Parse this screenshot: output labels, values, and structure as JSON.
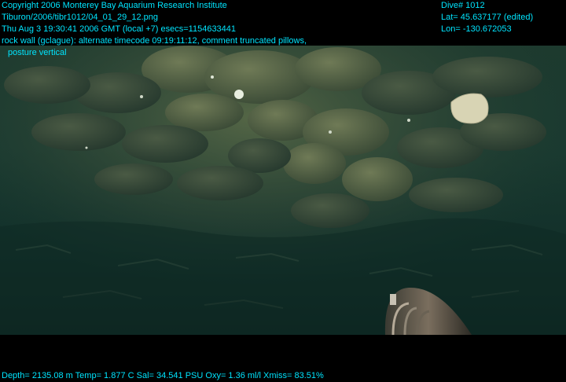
{
  "header_left": {
    "line1": "Copyright 2006 Monterey Bay Aquarium Research Institute",
    "line2": "Tiburon/2006/tibr1012/04_01_29_12.png",
    "line3": "Thu Aug  3 19:30:41 2006 GMT (local +7)  esecs=1154633441",
    "line4": "rock wall (gclague): alternate timecode 09:19:11:12, comment truncated pillows,",
    "line5": "posture vertical"
  },
  "header_right": {
    "dive": "Dive# 1012",
    "lat": "Lat= 45.637177 (edited)",
    "lon": "Lon= -130.672053"
  },
  "footer": {
    "telemetry": "Depth= 2135.08 m  Temp= 1.877 C  Sal= 34.541 PSU  Oxy= 1.36 ml/l  Xmiss= 83.51%"
  },
  "colors": {
    "overlay_text": "#00e5ff",
    "background": "#000000",
    "water": "#0f2a22"
  }
}
